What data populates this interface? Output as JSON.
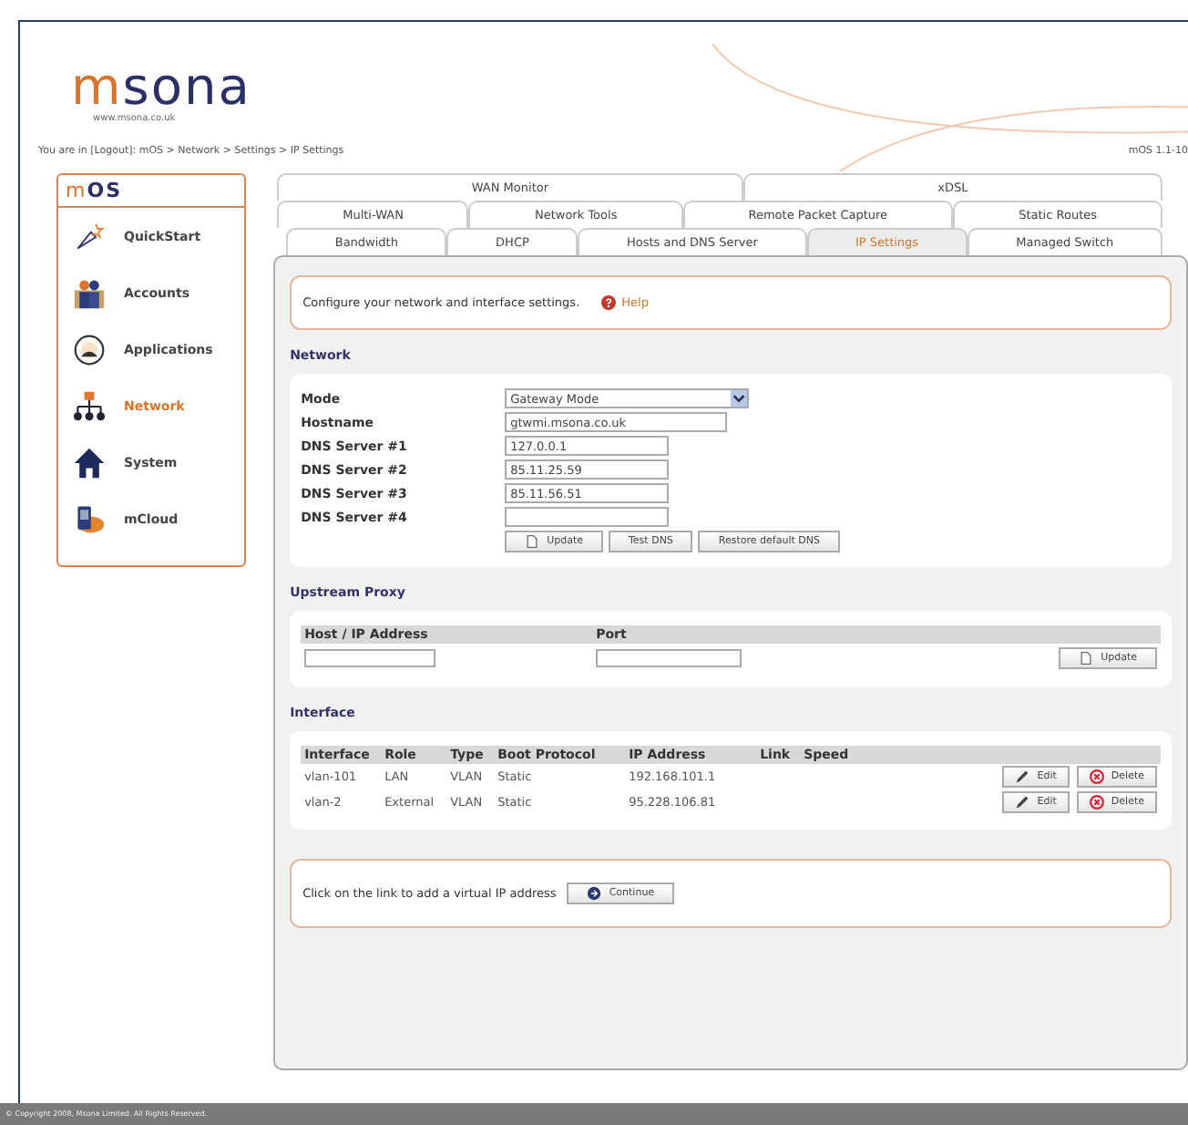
{
  "header": {
    "logo": "msona",
    "url": "www.msona.co.uk",
    "breadcrumb": {
      "prefix": "You are in",
      "logout": "[Logout]",
      "path": ":  mOS > Network > Settings > IP Settings"
    },
    "version": "mOS 1.1-10"
  },
  "sidebar": {
    "title": "mOS",
    "items": [
      {
        "label": "QuickStart",
        "selected": false
      },
      {
        "label": "Accounts",
        "selected": false
      },
      {
        "label": "Applications",
        "selected": false
      },
      {
        "label": "Network",
        "selected": true
      },
      {
        "label": "System",
        "selected": false
      },
      {
        "label": "mCloud",
        "selected": false
      }
    ]
  },
  "tab_rows": [
    [
      {
        "label": "WAN Monitor",
        "selected": false
      },
      {
        "label": "xDSL",
        "selected": false
      }
    ],
    [
      {
        "label": "Multi-WAN",
        "selected": false
      },
      {
        "label": "Network Tools",
        "selected": false
      },
      {
        "label": "Remote Packet Capture",
        "selected": false
      },
      {
        "label": "Static Routes",
        "selected": false
      }
    ],
    [
      {
        "label": "Bandwidth",
        "selected": false
      },
      {
        "label": "DHCP",
        "selected": false
      },
      {
        "label": "Hosts and DNS Server",
        "selected": false
      },
      {
        "label": "IP Settings",
        "selected": true
      },
      {
        "label": "Managed Switch",
        "selected": false
      }
    ]
  ],
  "intro": {
    "text": "Configure your network and interface settings.",
    "help": "Help"
  },
  "network": {
    "title": "Network",
    "fields": [
      {
        "label": "Mode",
        "kind": "select",
        "value": "Gateway Mode"
      },
      {
        "label": "Hostname",
        "kind": "text",
        "value": "gtwmi.msona.co.uk"
      },
      {
        "label": "DNS Server #1",
        "kind": "short",
        "value": "127.0.0.1"
      },
      {
        "label": "DNS Server #2",
        "kind": "short",
        "value": "85.11.25.59"
      },
      {
        "label": "DNS Server #3",
        "kind": "short",
        "value": "85.11.56.51"
      },
      {
        "label": "DNS Server #4",
        "kind": "short"
      }
    ],
    "buttons": [
      {
        "label": "Update",
        "kind": "update"
      },
      {
        "label": "Test DNS",
        "kind": "plain"
      },
      {
        "label": "Restore default DNS",
        "kind": "plain"
      }
    ]
  },
  "upstream_proxy": {
    "title": "Upstream Proxy",
    "columns": [
      "Host / IP Address",
      "Port"
    ],
    "button": "Update"
  },
  "interface": {
    "title": "Interface",
    "columns": [
      "Interface",
      "Role",
      "Type",
      "Boot Protocol",
      "IP Address",
      "Link",
      "Speed"
    ],
    "rows": [
      {
        "cells": [
          "vlan-101",
          "LAN",
          "VLAN",
          "Static",
          "192.168.101.1"
        ],
        "edit": "Edit",
        "delete": "Delete"
      },
      {
        "cells": [
          "vlan-2",
          "External",
          "VLAN",
          "Static",
          "95.228.106.81"
        ],
        "edit": "Edit",
        "delete": "Delete"
      }
    ]
  },
  "virtual_ip": {
    "text": "Click on the link to add a virtual IP address",
    "button": "Continue"
  },
  "footer": "© Copyright 2008, Msona Limited. All Rights Reserved."
}
